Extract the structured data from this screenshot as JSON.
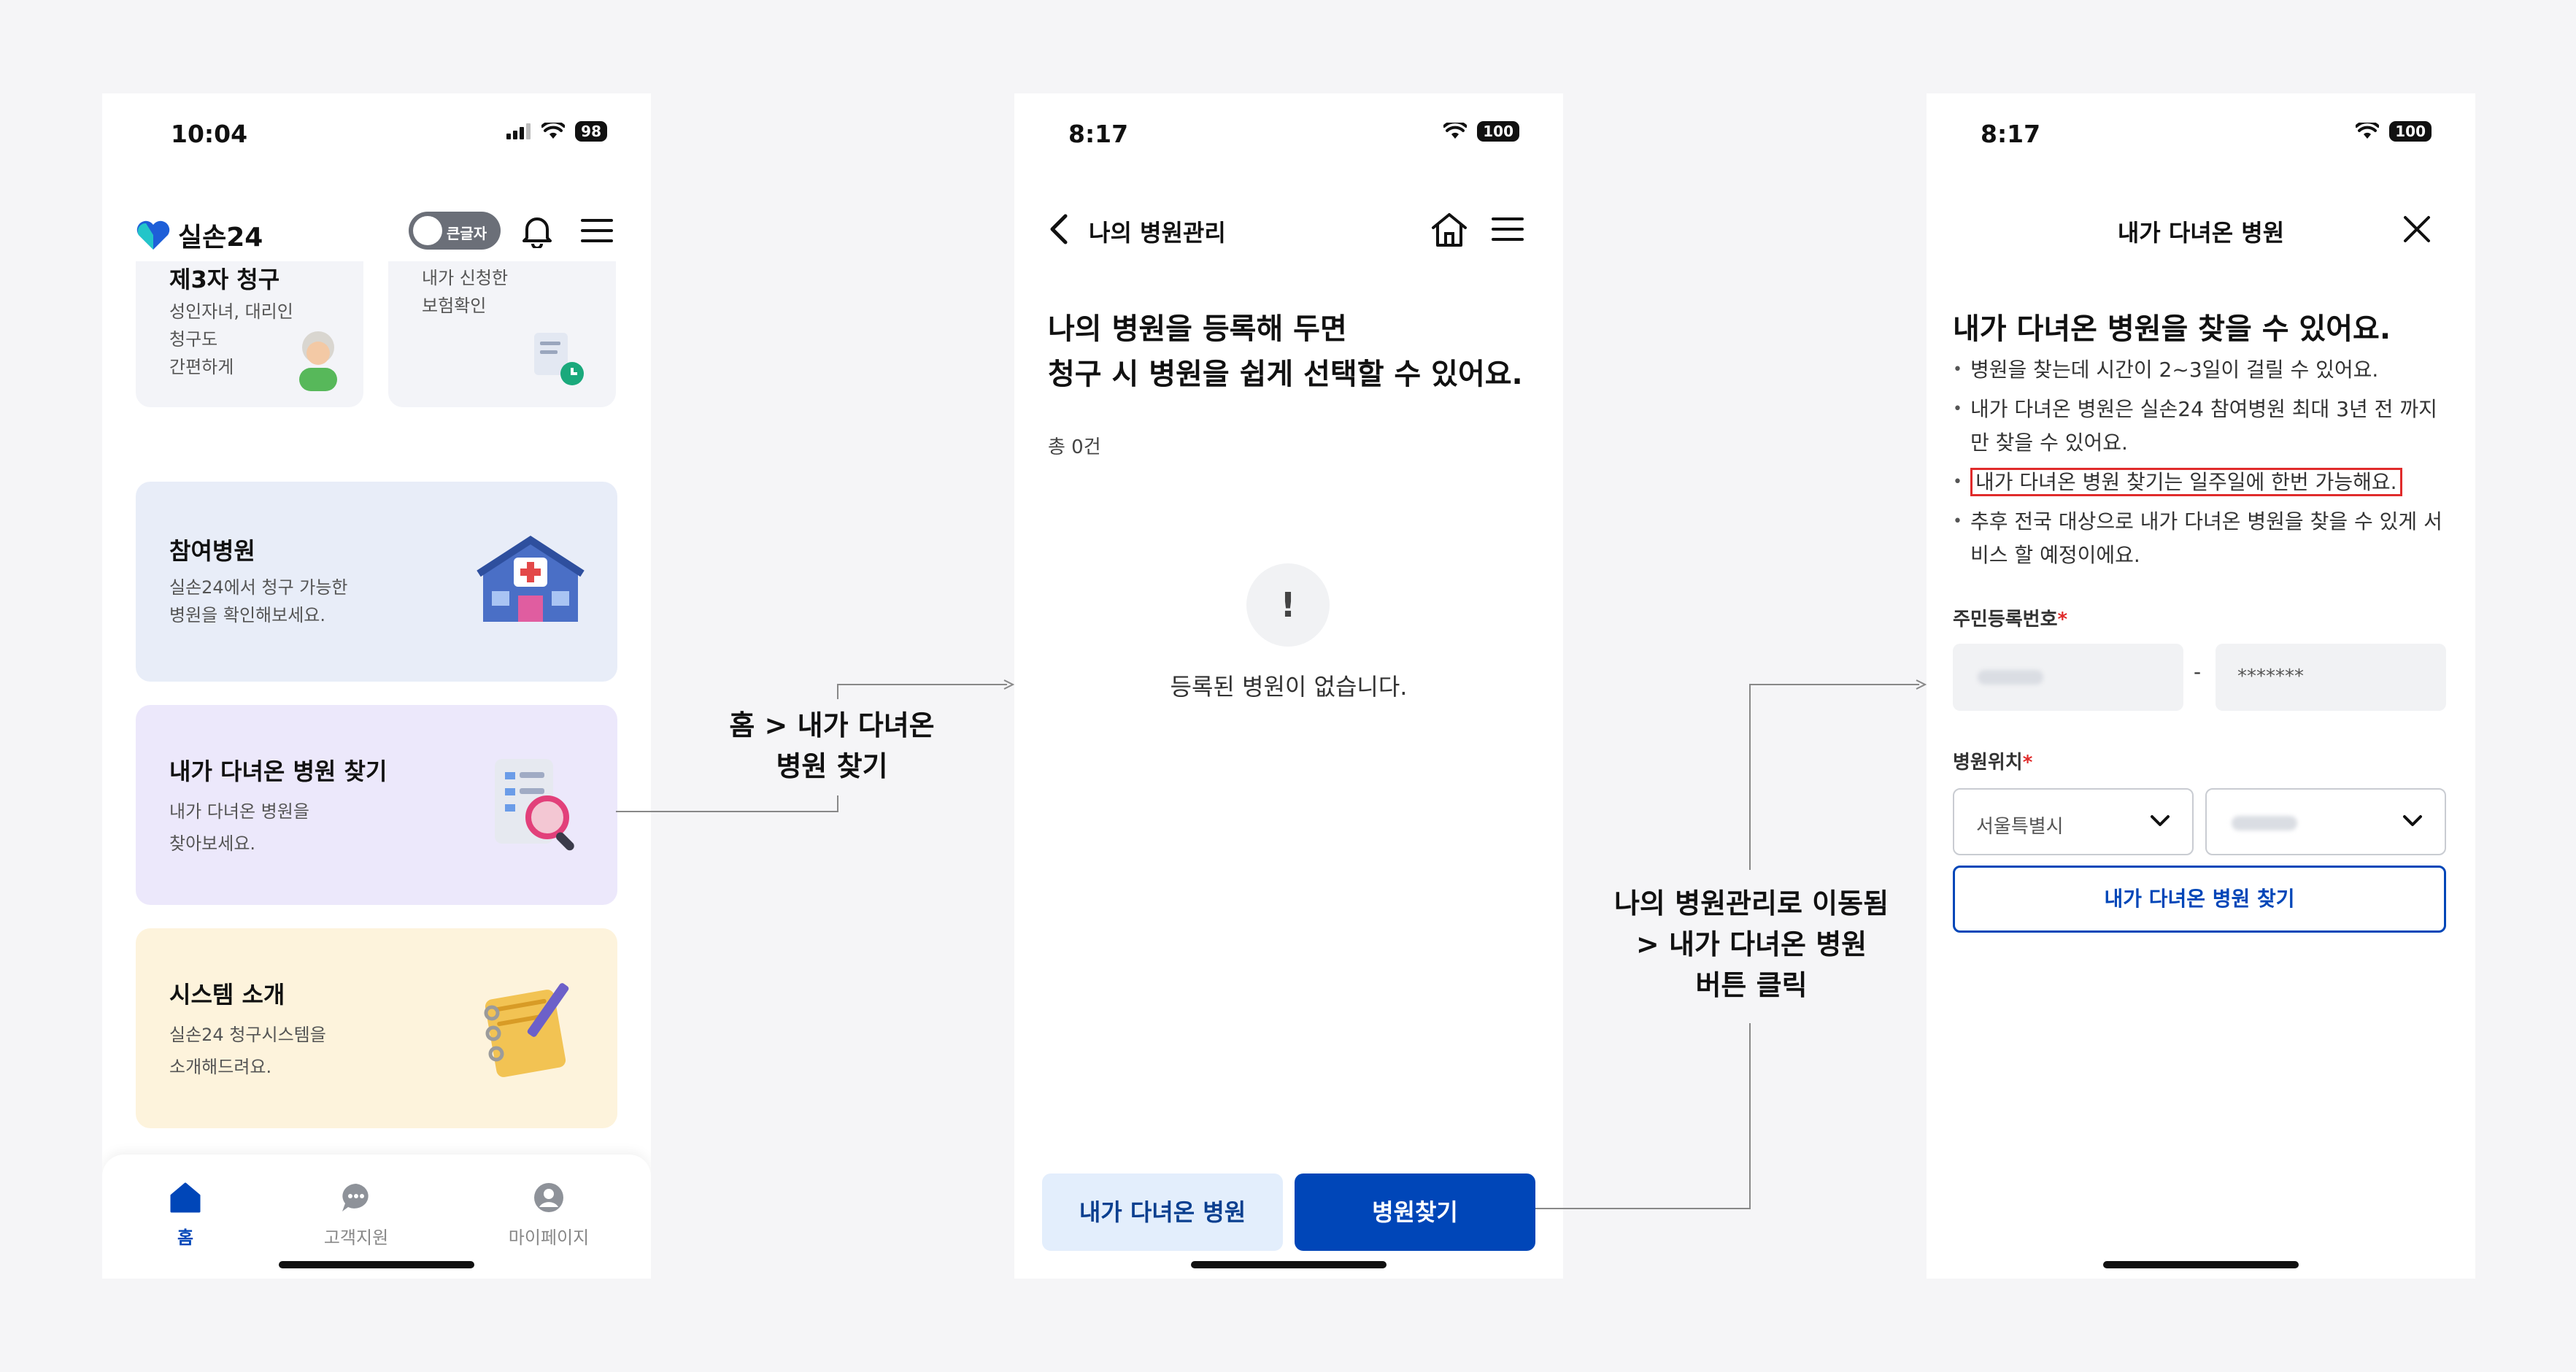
{
  "phone1": {
    "status_time": "10:04",
    "battery": "98",
    "logo_text": "실손24",
    "toggle_label": "큰글자",
    "top_cards": [
      {
        "title": "제3자 청구",
        "desc": "성인자녀, 대리인\n청구도\n간편하게"
      },
      {
        "title": "",
        "desc": "내가 신청한\n보험확인"
      }
    ],
    "cards": [
      {
        "title": "참여병원",
        "desc": "실손24에서 청구 가능한\n병원을 확인해보세요.",
        "bg": "#e8edf8"
      },
      {
        "title": "내가 다녀온 병원 찾기",
        "desc": "내가 다녀온 병원을\n찾아보세요.",
        "bg": "#ece8fb"
      },
      {
        "title": "시스템 소개",
        "desc": "실손24 청구시스템을\n소개해드려요.",
        "bg": "#fdf3dc"
      }
    ],
    "nav": [
      {
        "label": "홈",
        "icon": "home-icon"
      },
      {
        "label": "고객지원",
        "icon": "chat-icon"
      },
      {
        "label": "마이페이지",
        "icon": "user-icon"
      }
    ]
  },
  "phone2": {
    "status_time": "8:17",
    "battery": "100",
    "title": "나의 병원관리",
    "heading_line1": "나의 병원을 등록해 두면",
    "heading_line2": "청구 시 병원을 쉽게 선택할 수 있어요.",
    "count": "총 0건",
    "empty_mark": "!",
    "empty_text": "등록된 병원이 없습니다.",
    "btn_visited": "내가 다녀온 병원",
    "btn_search": "병원찾기"
  },
  "phone3": {
    "status_time": "8:17",
    "battery": "100",
    "title": "내가 다녀온 병원",
    "heading": "내가 다녀온 병원을 찾을 수 있어요.",
    "bullets": [
      "병원을 찾는데 시간이 2~3일이 걸릴 수 있어요.",
      "내가 다녀온 병원은 실손24 참여병원 최대 3년 전 까지 만 찾을 수 있어요.",
      "내가 다녀온 병원 찾기는 일주일에 한번 가능해요.",
      "추후 전국 대상으로 내가 다녀온 병원을 찾을 수 있게 서 비스 할 예정이에요."
    ],
    "id_label": "주민등록번호",
    "required_mark": "*",
    "id_dash": "-",
    "id_back": "*******",
    "location_label": "병원위치",
    "region": "서울특별시",
    "find_button": "내가 다녀온 병원 찾기"
  },
  "annotations": {
    "a1_line1": "홈 > 내가 다녀온",
    "a1_line2": "병원 찾기",
    "a2_line1": "나의 병원관리로 이동됨",
    "a2_line2": "> 내가 다녀온 병원",
    "a2_line3": "버튼 클릭"
  },
  "colors": {
    "primary": "#0046b8",
    "highlight": "#e02b2b"
  }
}
